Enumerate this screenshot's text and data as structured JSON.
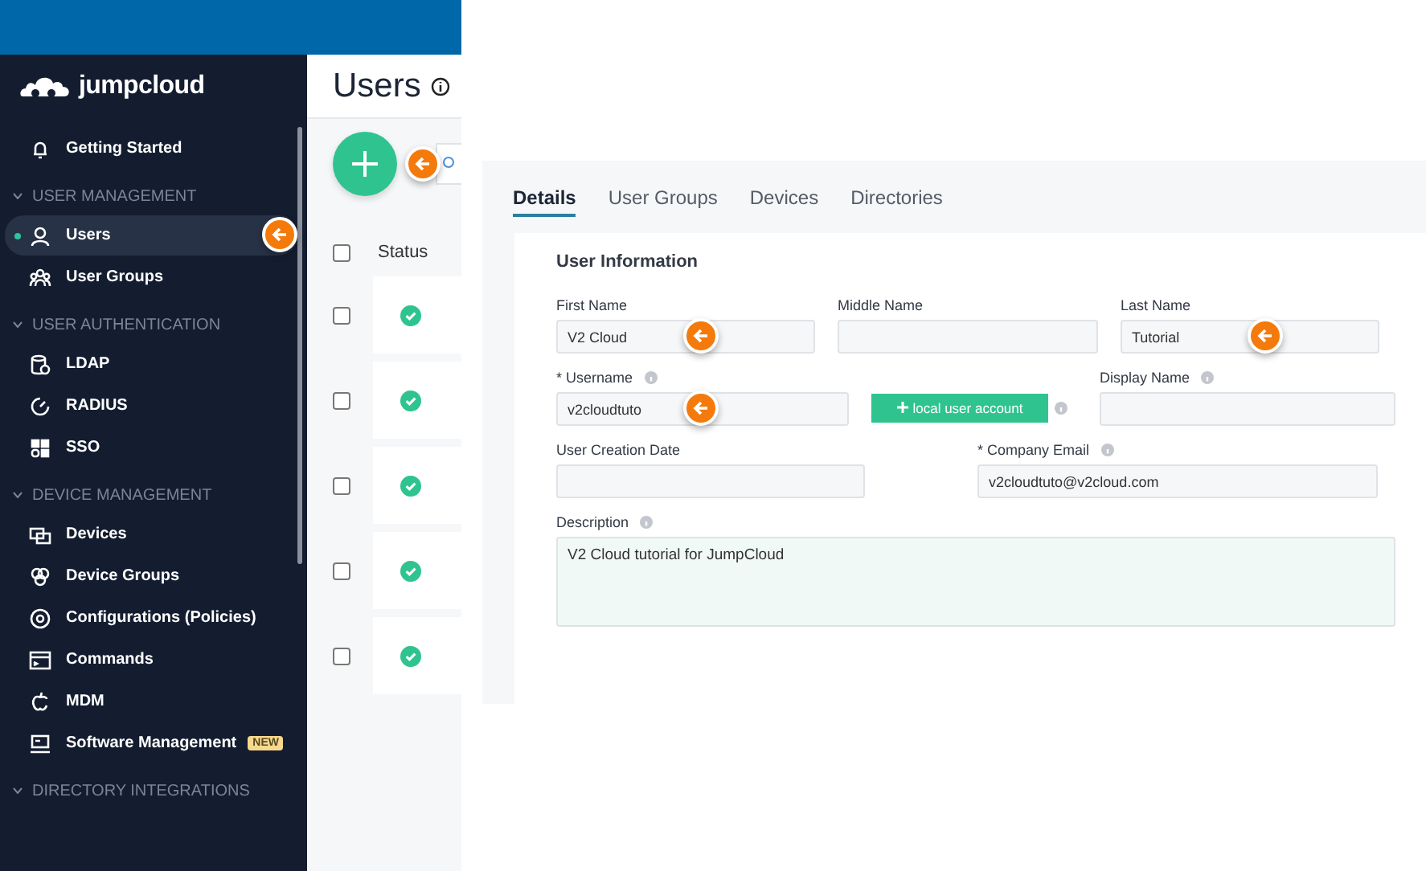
{
  "sidebar": {
    "logo": "jumpcloud",
    "items": [
      {
        "kind": "item",
        "label": "Getting Started",
        "selected": false,
        "marker": false
      },
      {
        "kind": "section",
        "label": "USER MANAGEMENT",
        "expanded": true
      },
      {
        "kind": "item",
        "label": "Users",
        "selected": true,
        "marker": true
      },
      {
        "kind": "item",
        "label": "User Groups",
        "selected": false,
        "marker": false
      },
      {
        "kind": "section",
        "label": "USER AUTHENTICATION",
        "expanded": true
      },
      {
        "kind": "item",
        "label": "LDAP",
        "selected": false,
        "marker": false
      },
      {
        "kind": "item",
        "label": "RADIUS",
        "selected": false,
        "marker": false
      },
      {
        "kind": "item",
        "label": "SSO",
        "selected": false,
        "marker": false
      },
      {
        "kind": "section",
        "label": "DEVICE MANAGEMENT",
        "expanded": true
      },
      {
        "kind": "item",
        "label": "Devices",
        "selected": false,
        "marker": false
      },
      {
        "kind": "item",
        "label": "Device Groups",
        "selected": false,
        "marker": false
      },
      {
        "kind": "item",
        "label": "Configurations (Policies)",
        "selected": false,
        "marker": false
      },
      {
        "kind": "item",
        "label": "Commands",
        "selected": false,
        "marker": false
      },
      {
        "kind": "item",
        "label": "MDM",
        "selected": false,
        "marker": false
      },
      {
        "kind": "item",
        "label": "Software Management",
        "selected": false,
        "marker": false,
        "badge": "NEW"
      },
      {
        "kind": "section",
        "label": "DIRECTORY INTEGRATIONS",
        "expanded": true
      }
    ]
  },
  "page": {
    "title": "Users",
    "add_button": {
      "marker": true
    },
    "table": {
      "header_checked": false,
      "columns": [
        "Status"
      ],
      "rows": [
        {
          "checked": false
        },
        {
          "checked": false
        },
        {
          "checked": false
        },
        {
          "checked": false
        },
        {
          "checked": false
        }
      ]
    }
  },
  "details": {
    "tabs": [
      {
        "label": "Details",
        "selected": true
      },
      {
        "label": "User Groups",
        "selected": false
      },
      {
        "label": "Devices",
        "selected": false
      },
      {
        "label": "Directories",
        "selected": false
      }
    ],
    "section_title": "User Information",
    "rows": [
      [
        {
          "kind": "field",
          "label": "First Name",
          "value": "V2 Cloud",
          "marker": true,
          "info": false
        },
        {
          "kind": "field",
          "label": "Middle Name",
          "marker": false,
          "info": false
        },
        {
          "kind": "field",
          "label": "Last Name",
          "value": "Tutorial",
          "marker": true,
          "info": false
        }
      ],
      [
        {
          "kind": "field",
          "label": "* Username",
          "value": "v2cloudtuto",
          "marker": true,
          "info": true
        },
        {
          "kind": "button",
          "label": "local user account",
          "info": true
        },
        {
          "kind": "field",
          "label": "Display Name",
          "marker": false,
          "info": true
        }
      ],
      [
        {
          "kind": "field",
          "label": "User Creation Date",
          "marker": false,
          "info": false
        },
        {
          "kind": "field",
          "label": "* Company Email",
          "value": "v2cloudtuto@v2cloud.com",
          "marker": false,
          "info": true
        }
      ]
    ],
    "description": {
      "label": "Description",
      "value": "V2 Cloud tutorial for JumpCloud",
      "info": true
    }
  }
}
